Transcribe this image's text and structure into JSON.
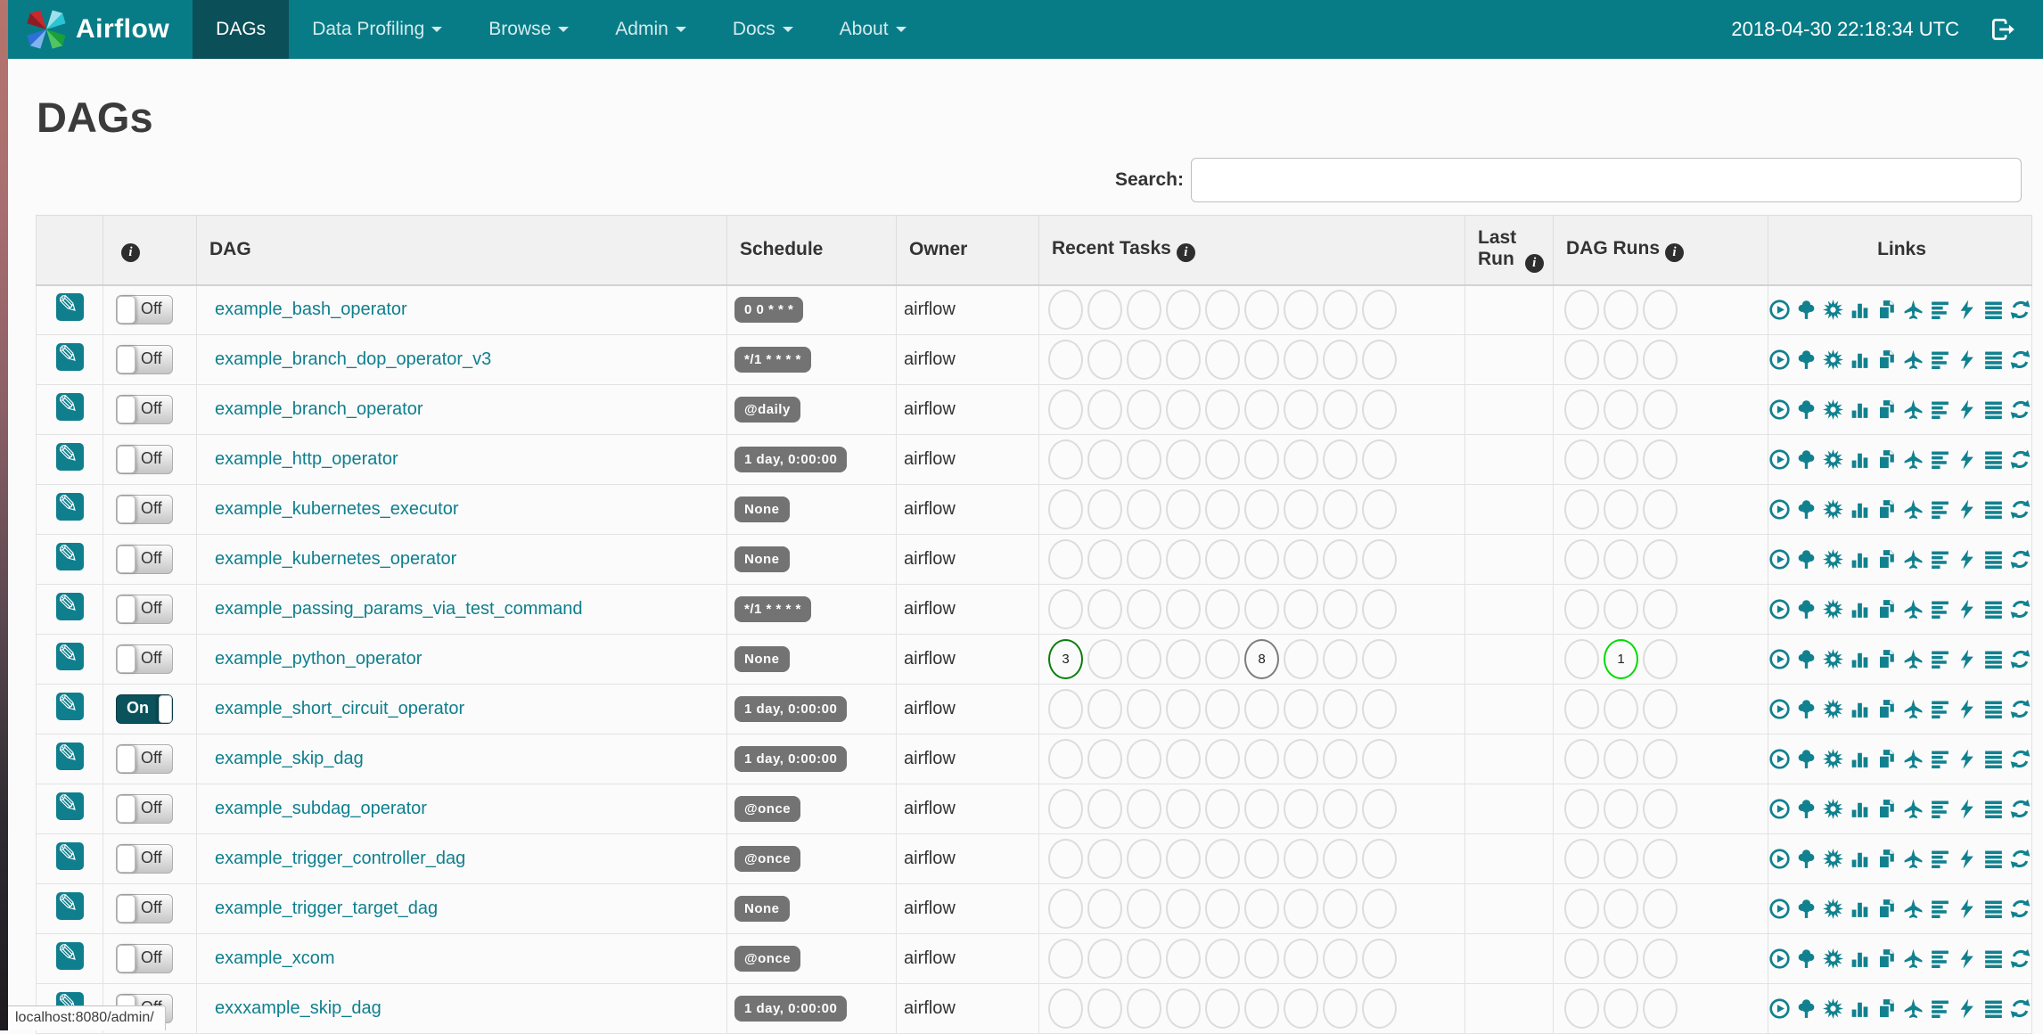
{
  "navbar": {
    "brand": "Airflow",
    "items": [
      {
        "label": "DAGs",
        "active": true,
        "caret": false
      },
      {
        "label": "Data Profiling",
        "active": false,
        "caret": true
      },
      {
        "label": "Browse",
        "active": false,
        "caret": true
      },
      {
        "label": "Admin",
        "active": false,
        "caret": true
      },
      {
        "label": "Docs",
        "active": false,
        "caret": true
      },
      {
        "label": "About",
        "active": false,
        "caret": true
      }
    ],
    "clock": "2018-04-30 22:18:34 UTC"
  },
  "page": {
    "title": "DAGs"
  },
  "search": {
    "label": "Search:",
    "value": ""
  },
  "status_tooltip": "localhost:8080/admin/",
  "colors": {
    "navbar": "#077C87",
    "navbar_active": "#0B4F58",
    "link_teal": "#0F7F8E",
    "badge_gray": "#737373",
    "state_success": "#0B7D0B",
    "state_running": "#01DB01",
    "state_queued": "#7d7d7d",
    "empty_circle": "#dcdcdc"
  },
  "toggle": {
    "on_label": "On",
    "off_label": "Off"
  },
  "table": {
    "columns": [
      {
        "label": "",
        "info": false
      },
      {
        "label": "",
        "info": true
      },
      {
        "label": "DAG",
        "info": false
      },
      {
        "label": "Schedule",
        "info": false
      },
      {
        "label": "Owner",
        "info": false
      },
      {
        "label": "Recent Tasks",
        "info": true
      },
      {
        "label": "Last Run",
        "info": true
      },
      {
        "label": "DAG Runs",
        "info": true
      },
      {
        "label": "Links",
        "info": false
      }
    ],
    "recent_task_slots": 9,
    "dag_run_slots": 3,
    "links": [
      {
        "name": "trigger-dag-icon",
        "symbol": "play-circle"
      },
      {
        "name": "tree-view-icon",
        "symbol": "tree"
      },
      {
        "name": "graph-view-icon",
        "symbol": "burst"
      },
      {
        "name": "task-duration-icon",
        "symbol": "bar-chart"
      },
      {
        "name": "task-tries-icon",
        "symbol": "copy-pages"
      },
      {
        "name": "landing-times-icon",
        "symbol": "plane"
      },
      {
        "name": "gantt-view-icon",
        "symbol": "align-left"
      },
      {
        "name": "code-view-icon",
        "symbol": "bolt"
      },
      {
        "name": "logs-icon",
        "symbol": "align-justify"
      },
      {
        "name": "refresh-icon",
        "symbol": "refresh"
      }
    ],
    "rows": [
      {
        "name": "example_bash_operator",
        "paused": true,
        "schedule": "0 0 * * *",
        "owner": "airflow",
        "last_run": "",
        "recent_tasks": [],
        "dag_runs": []
      },
      {
        "name": "example_branch_dop_operator_v3",
        "paused": true,
        "schedule": "*/1 * * * *",
        "owner": "airflow",
        "last_run": "",
        "recent_tasks": [],
        "dag_runs": []
      },
      {
        "name": "example_branch_operator",
        "paused": true,
        "schedule": "@daily",
        "owner": "airflow",
        "last_run": "",
        "recent_tasks": [],
        "dag_runs": []
      },
      {
        "name": "example_http_operator",
        "paused": true,
        "schedule": "1 day, 0:00:00",
        "owner": "airflow",
        "last_run": "",
        "recent_tasks": [],
        "dag_runs": []
      },
      {
        "name": "example_kubernetes_executor",
        "paused": true,
        "schedule": "None",
        "owner": "airflow",
        "last_run": "",
        "recent_tasks": [],
        "dag_runs": []
      },
      {
        "name": "example_kubernetes_operator",
        "paused": true,
        "schedule": "None",
        "owner": "airflow",
        "last_run": "",
        "recent_tasks": [],
        "dag_runs": []
      },
      {
        "name": "example_passing_params_via_test_command",
        "paused": true,
        "schedule": "*/1 * * * *",
        "owner": "airflow",
        "last_run": "",
        "recent_tasks": [],
        "dag_runs": []
      },
      {
        "name": "example_python_operator",
        "paused": true,
        "schedule": "None",
        "owner": "airflow",
        "last_run": "",
        "recent_tasks": [
          {
            "slot": 0,
            "count": "3",
            "state": "state_success"
          },
          {
            "slot": 5,
            "count": "8",
            "state": "state_queued"
          }
        ],
        "dag_runs": [
          {
            "slot": 1,
            "count": "1",
            "state": "state_running"
          }
        ]
      },
      {
        "name": "example_short_circuit_operator",
        "paused": false,
        "schedule": "1 day, 0:00:00",
        "owner": "airflow",
        "last_run": "",
        "recent_tasks": [],
        "dag_runs": []
      },
      {
        "name": "example_skip_dag",
        "paused": true,
        "schedule": "1 day, 0:00:00",
        "owner": "airflow",
        "last_run": "",
        "recent_tasks": [],
        "dag_runs": []
      },
      {
        "name": "example_subdag_operator",
        "paused": true,
        "schedule": "@once",
        "owner": "airflow",
        "last_run": "",
        "recent_tasks": [],
        "dag_runs": []
      },
      {
        "name": "example_trigger_controller_dag",
        "paused": true,
        "schedule": "@once",
        "owner": "airflow",
        "last_run": "",
        "recent_tasks": [],
        "dag_runs": []
      },
      {
        "name": "example_trigger_target_dag",
        "paused": true,
        "schedule": "None",
        "owner": "airflow",
        "last_run": "",
        "recent_tasks": [],
        "dag_runs": []
      },
      {
        "name": "example_xcom",
        "paused": true,
        "schedule": "@once",
        "owner": "airflow",
        "last_run": "",
        "recent_tasks": [],
        "dag_runs": []
      },
      {
        "name": "exxxample_skip_dag",
        "paused": true,
        "schedule": "1 day, 0:00:00",
        "owner": "airflow",
        "last_run": "",
        "recent_tasks": [],
        "dag_runs": []
      }
    ]
  }
}
